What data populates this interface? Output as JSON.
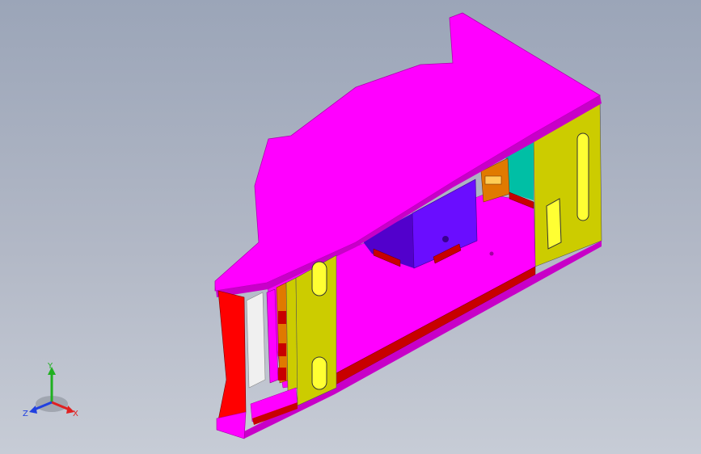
{
  "viewport": {
    "background_top": "#9ba5b8",
    "background_bottom": "#c7ccd6"
  },
  "model": {
    "colors": {
      "top_plate": "#ff00ff",
      "top_plate_edge": "#c800c8",
      "side_plate": "#cccc00",
      "side_plate_dark": "#a6a600",
      "end_plate": "#ff0000",
      "block": "#6a0dff",
      "block_dark": "#5200cc",
      "rail": "#c80000",
      "inner_teal": "#00bfa5",
      "inner_orange": "#e07a00",
      "slot_fill": "#ffff00"
    }
  },
  "triad": {
    "x_label": "X",
    "y_label": "Y",
    "z_label": "Z",
    "x_color": "#e02020",
    "y_color": "#20b020",
    "z_color": "#2040e0"
  }
}
